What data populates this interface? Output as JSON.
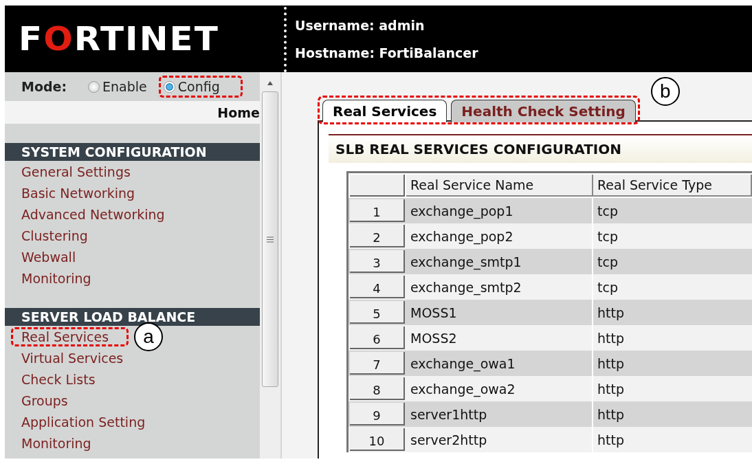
{
  "header": {
    "logo": "FORTINET",
    "username": "Username: admin",
    "hostname": "Hostname: FortiBalancer"
  },
  "mode": {
    "label": "Mode:",
    "options": [
      {
        "label": "Enable",
        "selected": false,
        "highlighted": false
      },
      {
        "label": "Config",
        "selected": true,
        "highlighted": true
      }
    ]
  },
  "home_link": "Home",
  "sidebar": [
    {
      "title": "SYSTEM CONFIGURATION",
      "items": [
        {
          "label": "General Settings",
          "highlighted": false
        },
        {
          "label": "Basic Networking",
          "highlighted": false
        },
        {
          "label": "Advanced Networking",
          "highlighted": false
        },
        {
          "label": "Clustering",
          "highlighted": false
        },
        {
          "label": "Webwall",
          "highlighted": false
        },
        {
          "label": "Monitoring",
          "highlighted": false
        }
      ]
    },
    {
      "title": "SERVER LOAD BALANCE",
      "items": [
        {
          "label": "Real Services",
          "highlighted": true,
          "callout": "a"
        },
        {
          "label": "Virtual Services",
          "highlighted": false
        },
        {
          "label": "Check Lists",
          "highlighted": false
        },
        {
          "label": "Groups",
          "highlighted": false
        },
        {
          "label": "Application Setting",
          "highlighted": false
        },
        {
          "label": "Monitoring",
          "highlighted": false
        }
      ]
    }
  ],
  "tabs": [
    {
      "label": "Real Services",
      "selected": true
    },
    {
      "label": "Health Check Setting",
      "selected": false
    }
  ],
  "tabs_callout": "b",
  "section_title": "SLB REAL SERVICES CONFIGURATION",
  "table": {
    "columns": [
      "Real Service Name",
      "Real Service Type"
    ],
    "rows": [
      {
        "num": "1",
        "name": "exchange_pop1",
        "type": "tcp"
      },
      {
        "num": "2",
        "name": "exchange_pop2",
        "type": "tcp"
      },
      {
        "num": "3",
        "name": "exchange_smtp1",
        "type": "tcp"
      },
      {
        "num": "4",
        "name": "exchange_smtp2",
        "type": "tcp"
      },
      {
        "num": "5",
        "name": "MOSS1",
        "type": "http"
      },
      {
        "num": "6",
        "name": "MOSS2",
        "type": "http"
      },
      {
        "num": "7",
        "name": "exchange_owa1",
        "type": "http"
      },
      {
        "num": "8",
        "name": "exchange_owa2",
        "type": "http"
      },
      {
        "num": "9",
        "name": "server1http",
        "type": "http"
      },
      {
        "num": "10",
        "name": "server2http",
        "type": "http"
      }
    ]
  }
}
